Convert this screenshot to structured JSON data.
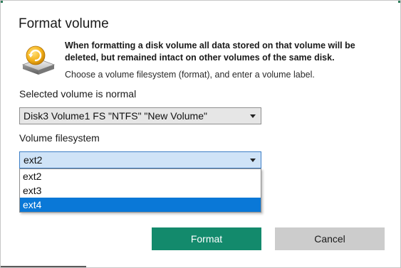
{
  "dialog": {
    "title": "Format volume",
    "warning": "When formatting a disk volume all data stored on that volume will be deleted, but remained intact on other volumes of the same disk.",
    "hint": "Choose a volume filesystem (format), and enter a volume label."
  },
  "volume": {
    "label": "Selected volume is normal",
    "selected": "Disk3 Volume1 FS \"NTFS\" \"New Volume\""
  },
  "filesystem": {
    "label": "Volume filesystem",
    "selected": "ext2",
    "options": [
      "ext2",
      "ext3",
      "ext4"
    ],
    "highlighted": "ext4"
  },
  "buttons": {
    "format": "Format",
    "cancel": "Cancel"
  },
  "icons": {
    "app": "disk-format-icon",
    "caret": "chevron-down-icon"
  },
  "colors": {
    "primary_button": "#138a6c",
    "secondary_button": "#cccccc",
    "highlight": "#0a78d7",
    "active_select": "#cfe3f7"
  }
}
